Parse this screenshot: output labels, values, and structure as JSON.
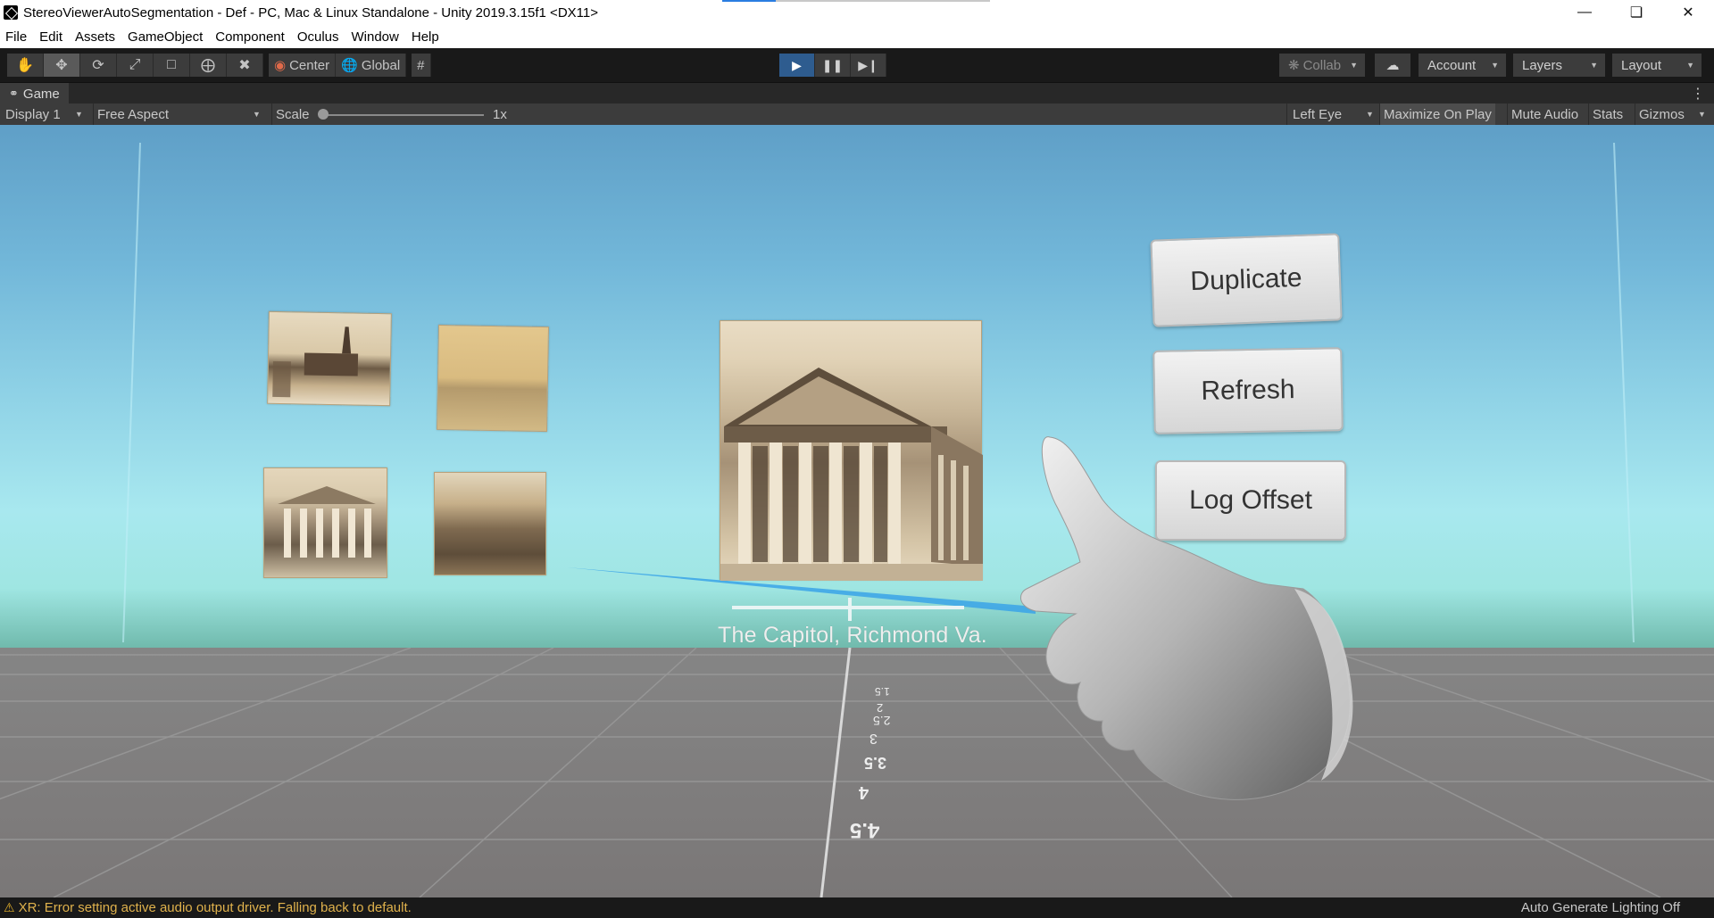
{
  "window": {
    "title": "StereoViewerAutoSegmentation - Def - PC, Mac & Linux Standalone - Unity 2019.3.15f1 <DX11>",
    "controls": [
      "minimize-icon",
      "restore-icon",
      "close-icon"
    ]
  },
  "menu": [
    "File",
    "Edit",
    "Assets",
    "GameObject",
    "Component",
    "Oculus",
    "Window",
    "Help"
  ],
  "toolbar": {
    "tools": [
      "hand-icon",
      "move-icon",
      "rotate-icon",
      "scale-icon",
      "rect-icon",
      "transform-icon",
      "custom-tool-icon"
    ],
    "pivot_mode": "Center",
    "pivot_rotation": "Global",
    "collab": "Collab",
    "account": "Account",
    "layers": "Layers",
    "layout": "Layout"
  },
  "tabs": {
    "game_label": "Game"
  },
  "game_toolbar": {
    "display": "Display 1",
    "aspect": "Free Aspect",
    "scale_label": "Scale",
    "scale_value": "1x",
    "eye": "Left Eye",
    "maximize_on_play": "Maximize On Play",
    "mute_audio": "Mute Audio",
    "stats": "Stats",
    "gizmos": "Gizmos"
  },
  "scene": {
    "buttons": {
      "duplicate": "Duplicate",
      "refresh": "Refresh",
      "log_offset": "Log Offset"
    },
    "caption": "The Capitol, Richmond Va.",
    "floor_labels": [
      "1.5",
      "2",
      "2.5",
      "3",
      "3.5",
      "4",
      "4.5"
    ],
    "thumbnails": [
      "church-photo",
      "field-photo",
      "capitol-photo",
      "landscape-photo"
    ],
    "main_photo": "capitol-building-photo"
  },
  "status": {
    "message": "XR: Error setting active audio output driver.  Falling back to default.",
    "right": "Auto Generate Lighting Off"
  },
  "colors": {
    "accent": "#2e5c8f",
    "warning": "#e0b24c",
    "sky": "#8fd2e6",
    "floor": "#858585"
  }
}
